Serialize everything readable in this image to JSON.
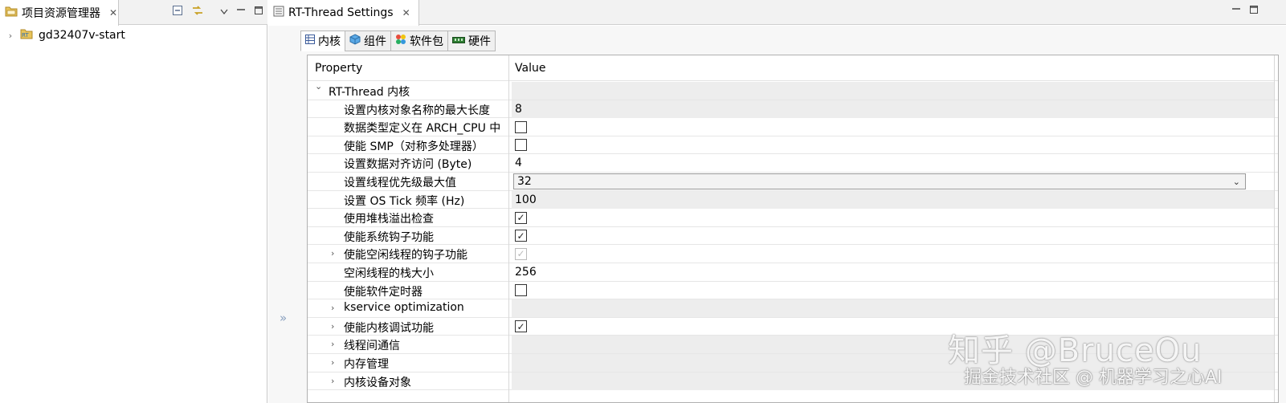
{
  "left_view": {
    "tab_title": "项目资源管理器",
    "tree": [
      {
        "label": "gd32407v-start"
      }
    ]
  },
  "editor": {
    "tab_title": "RT-Thread Settings",
    "inner_tabs": [
      {
        "label": "内核",
        "active": true
      },
      {
        "label": "组件",
        "active": false
      },
      {
        "label": "软件包",
        "active": false
      },
      {
        "label": "硬件",
        "active": false
      }
    ],
    "columns": {
      "property": "Property",
      "value": "Value"
    },
    "rows": [
      {
        "name": "RT-Thread 内核",
        "level": 0,
        "expanded": true,
        "type": "group"
      },
      {
        "name": "设置内核对象名称的最大长度",
        "level": 1,
        "type": "text",
        "value": "8"
      },
      {
        "name": "数据类型定义在 ARCH_CPU 中",
        "level": 1,
        "type": "checkbox",
        "checked": false
      },
      {
        "name": "使能 SMP（对称多处理器）",
        "level": 1,
        "type": "checkbox",
        "checked": false
      },
      {
        "name": "设置数据对齐访问 (Byte)",
        "level": 1,
        "type": "text",
        "value": "4"
      },
      {
        "name": "设置线程优先级最大值",
        "level": 1,
        "type": "combo",
        "value": "32"
      },
      {
        "name": "设置 OS Tick 频率 (Hz)",
        "level": 1,
        "type": "text",
        "value": "100"
      },
      {
        "name": "使用堆栈溢出检查",
        "level": 1,
        "type": "checkbox",
        "checked": true
      },
      {
        "name": "使能系统钩子功能",
        "level": 1,
        "type": "checkbox",
        "checked": true
      },
      {
        "name": "使能空闲线程的钩子功能",
        "level": 1,
        "type": "checkbox",
        "checked": true,
        "disabled": true,
        "expandable": true
      },
      {
        "name": "空闲线程的栈大小",
        "level": 1,
        "type": "text",
        "value": "256"
      },
      {
        "name": "使能软件定时器",
        "level": 1,
        "type": "checkbox",
        "checked": false
      },
      {
        "name": "kservice optimization",
        "level": 1,
        "type": "group",
        "expandable": true
      },
      {
        "name": "使能内核调试功能",
        "level": 1,
        "type": "checkbox",
        "checked": true,
        "expandable": true
      },
      {
        "name": "线程间通信",
        "level": 1,
        "type": "group",
        "expandable": true
      },
      {
        "name": "内存管理",
        "level": 1,
        "type": "group",
        "expandable": true
      },
      {
        "name": "内核设备对象",
        "level": 1,
        "type": "group",
        "expandable": true
      }
    ]
  },
  "watermark": {
    "line1": "知乎 @BruceOu",
    "line2": "掘金技术社区 @ 机器学习之心AI"
  },
  "icons": [
    "project-explorer-icon",
    "collapse-all-icon",
    "link-editor-icon",
    "view-menu-icon",
    "minimize-icon",
    "maximize-icon",
    "project-icon",
    "settings-icon",
    "table-icon",
    "cube-icon",
    "package-icon",
    "hardware-icon",
    "check-icon"
  ]
}
